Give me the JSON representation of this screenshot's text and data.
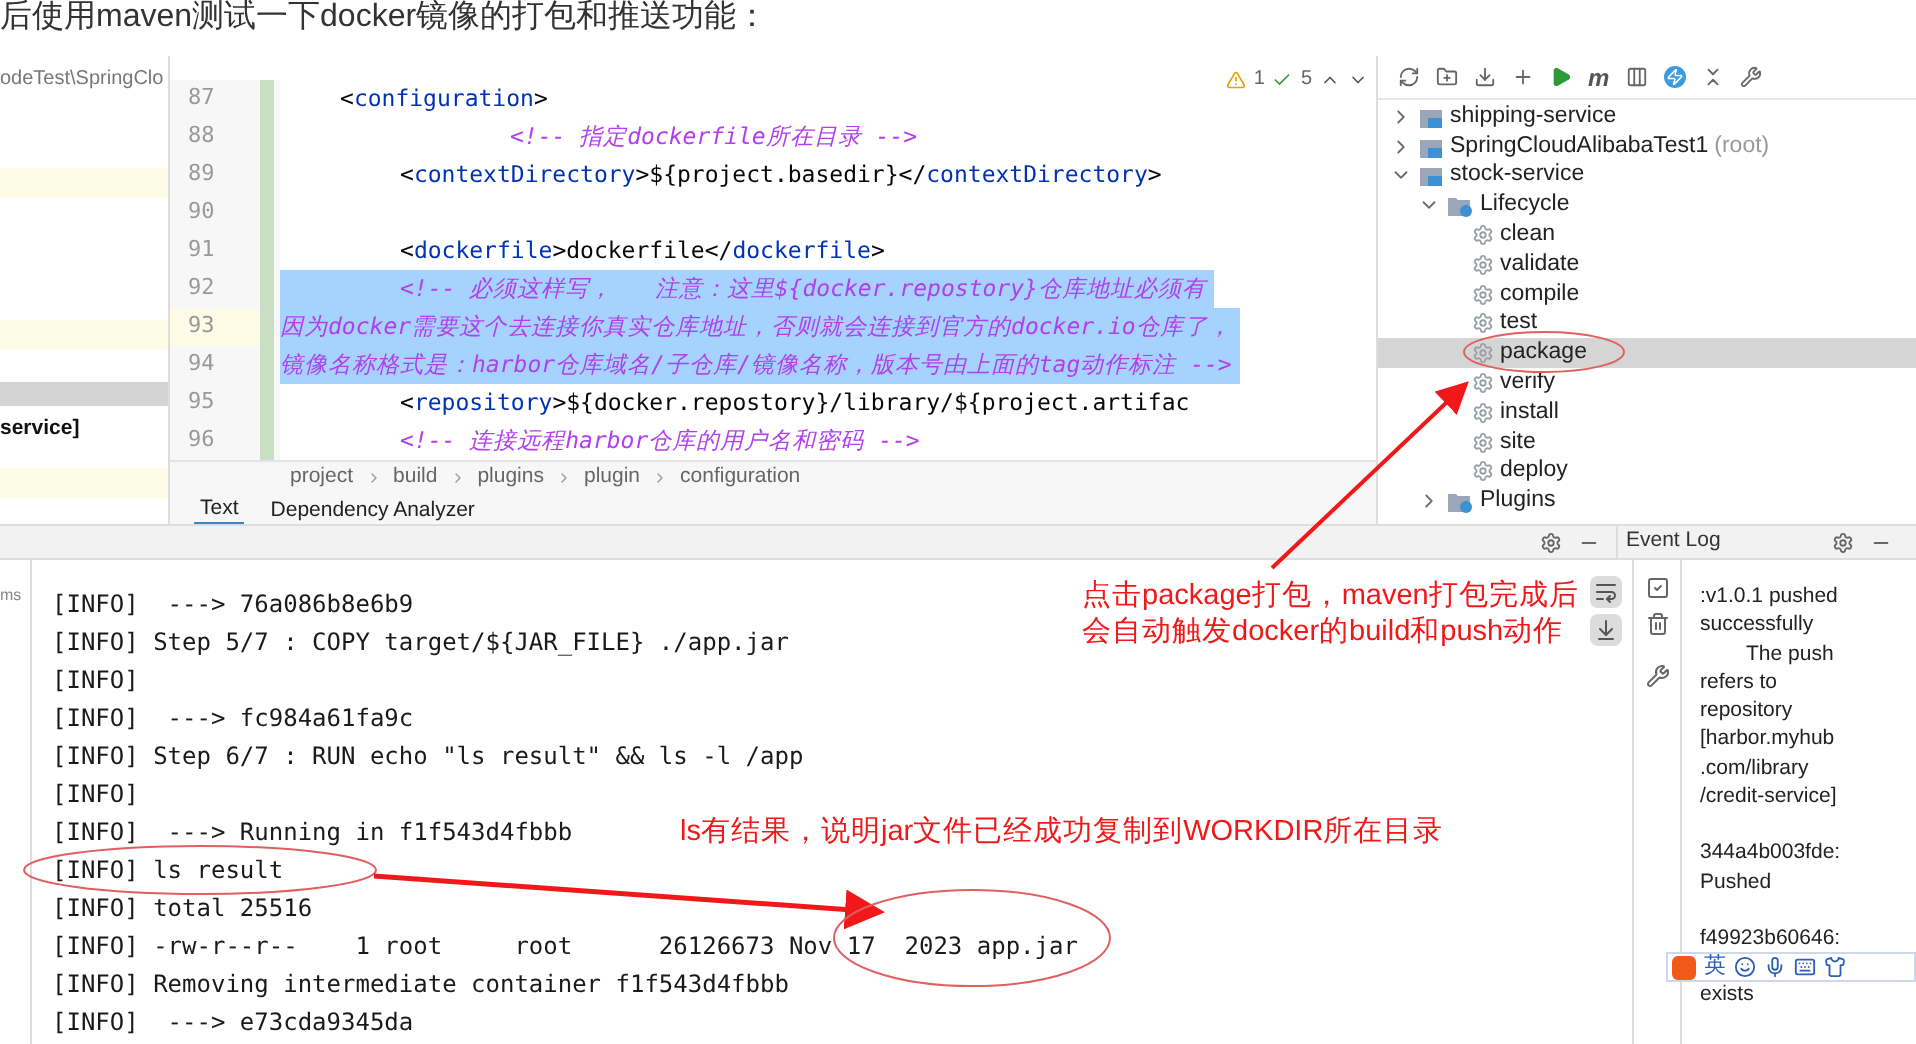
{
  "article_sentence": "后使用maven测试一下docker镜像的打包和推送功能：",
  "project_panel": {
    "path": "odeTest\\SpringClo",
    "item": "service]"
  },
  "editor": {
    "inspections": {
      "warnings": "1",
      "checks": "5"
    },
    "lines": [
      {
        "number": "87",
        "selected": false,
        "segments": [
          {
            "t": "<",
            "kind": "plain"
          },
          {
            "t": "configuration",
            "kind": "tag"
          },
          {
            "t": ">",
            "kind": "plain"
          }
        ]
      },
      {
        "number": "88",
        "selected": false,
        "segments": [
          {
            "t": "<!-- 指定dockerfile所在目录 -->",
            "kind": "comment"
          }
        ]
      },
      {
        "number": "89",
        "selected": false,
        "segments": [
          {
            "t": "<",
            "kind": "plain"
          },
          {
            "t": "contextDirectory",
            "kind": "tag"
          },
          {
            "t": ">${project.basedir}</",
            "kind": "plain"
          },
          {
            "t": "contextDirectory",
            "kind": "tag"
          },
          {
            "t": ">",
            "kind": "plain"
          }
        ]
      },
      {
        "number": "90"
      },
      {
        "number": "91",
        "selected": false,
        "segments": [
          {
            "t": "<",
            "kind": "plain"
          },
          {
            "t": "dockerfile",
            "kind": "tag"
          },
          {
            "t": ">dockerfile</",
            "kind": "plain"
          },
          {
            "t": "dockerfile",
            "kind": "tag"
          },
          {
            "t": ">",
            "kind": "plain"
          }
        ]
      },
      {
        "number": "92",
        "selected": true,
        "segments": [
          {
            "t": "<!-- 必须这样写，   注意：这里${docker.repostory}仓库地址必须有",
            "kind": "comment"
          }
        ]
      },
      {
        "number": "93",
        "selected": true,
        "segments": [
          {
            "t": "因为docker需要这个去连接你真实仓库地址，否则就会连接到官方的docker.io仓库了，",
            "kind": "comment"
          }
        ]
      },
      {
        "number": "94",
        "selected": true,
        "segments": [
          {
            "t": "镜像名称格式是：harbor仓库域名/子仓库/镜像名称，版本号由上面的tag动作标注 -->",
            "kind": "comment"
          }
        ]
      },
      {
        "number": "95",
        "selected": false,
        "segments": [
          {
            "t": "<",
            "kind": "plain"
          },
          {
            "t": "repository",
            "kind": "tag"
          },
          {
            "t": ">${docker.repostory}/library/${project.artifac",
            "kind": "plain"
          }
        ]
      },
      {
        "number": "96",
        "selected": false,
        "segments": [
          {
            "t": "<!-- 连接远程harbor仓库的用户名和密码 -->",
            "kind": "comment"
          }
        ]
      }
    ],
    "breadcrumbs": [
      "project",
      "build",
      "plugins",
      "plugin",
      "configuration"
    ],
    "tabs": [
      {
        "label": "Text",
        "selected": true
      },
      {
        "label": "Dependency Analyzer",
        "selected": false
      }
    ]
  },
  "maven": {
    "toolbar_m": "m",
    "tree": [
      {
        "label": "shipping-service",
        "kind": "module",
        "expanded": false,
        "selected": false
      },
      {
        "label": "SpringCloudAlibabaTest1",
        "note": "(root)",
        "kind": "module",
        "expanded": false,
        "selected": false
      },
      {
        "label": "stock-service",
        "kind": "module",
        "expanded": true,
        "selected": false,
        "children": [
          {
            "label": "Lifecycle",
            "kind": "folder",
            "expanded": true,
            "selected": false,
            "children": [
              {
                "label": "clean",
                "kind": "goal",
                "selected": false
              },
              {
                "label": "validate",
                "kind": "goal",
                "selected": false
              },
              {
                "label": "compile",
                "kind": "goal",
                "selected": false
              },
              {
                "label": "test",
                "kind": "goal",
                "selected": false
              },
              {
                "label": "package",
                "kind": "goal",
                "selected": true
              },
              {
                "label": "verify",
                "kind": "goal",
                "selected": false
              },
              {
                "label": "install",
                "kind": "goal",
                "selected": false
              },
              {
                "label": "site",
                "kind": "goal",
                "selected": false
              },
              {
                "label": "deploy",
                "kind": "goal",
                "selected": false
              }
            ]
          },
          {
            "label": "Plugins",
            "kind": "folder",
            "expanded": false,
            "selected": false
          }
        ]
      }
    ]
  },
  "run_panel": {
    "side_label": "ms",
    "console": [
      "[INFO]  ---> 76a086b8e6b9",
      "[INFO] Step 5/7 : COPY target/${JAR_FILE} ./app.jar",
      "[INFO]",
      "[INFO]  ---> fc984a61fa9c",
      "[INFO] Step 6/7 : RUN echo \"ls result\" && ls -l /app",
      "[INFO]",
      "[INFO]  ---> Running in f1f543d4fbbb",
      "[INFO] ls result",
      "[INFO] total 25516",
      "[INFO] -rw-r--r--    1 root     root      26126673 Nov 17  2023 app.jar",
      "[INFO] Removing intermediate container f1f543d4fbbb",
      "[INFO]  ---> e73cda9345da"
    ]
  },
  "event_log": {
    "title": "Event Log",
    "entries": [
      {
        "lines": [
          ":v1.0.1 pushed",
          "successfully"
        ]
      },
      {
        "lines": [
          "The push",
          "refers to",
          "repository",
          "[harbor.myhub",
          ".com/library",
          "/credit-service]"
        ]
      },
      {
        "lines": [
          "344a4b003fde:",
          "Pushed"
        ]
      },
      {
        "lines": [
          "f49923b60646:"
        ]
      },
      {
        "lines": [
          "exists"
        ]
      }
    ]
  },
  "ime_bar": {
    "label": "英"
  },
  "annotations": {
    "package_note": [
      "点击package打包，maven打包完成后",
      "会自动触发docker的build和push动作"
    ],
    "ls_note": "ls有结果，说明jar文件已经成功复制到WORKDIR所在目录"
  }
}
